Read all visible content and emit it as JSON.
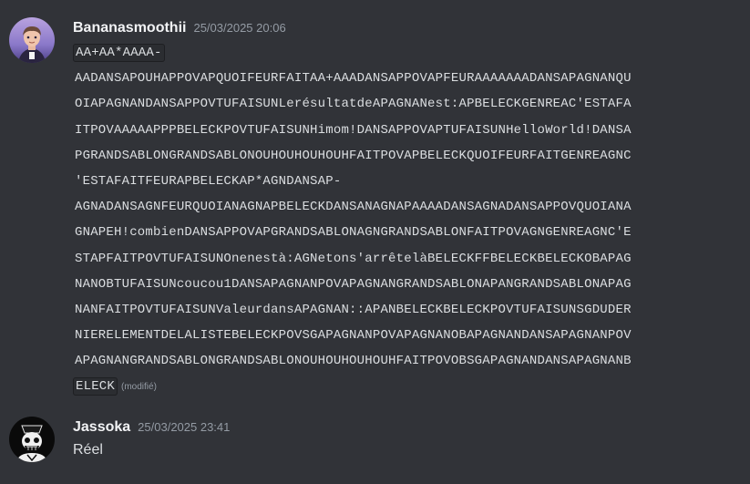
{
  "messages": [
    {
      "username": "Bananasmoothii",
      "timestamp": "25/03/2025 20:06",
      "lines": [
        "AA+AA*AAAA-",
        "AADANSAPOUHAPPOVAPQUOIFEURFAITAA+AAADANSAPPOVAPFEURAAAAAAADANSAPAGNANQU",
        "OIAPAGNANDANSAPPOVTUFAISUNLerésultatdeAPAGNANest:APBELECKGENREAC'ESTAFA",
        "ITPOVAAAAAPPPBELECKPOVTUFAISUNHimom!DANSAPPOVAPTUFAISUNHelloWorld!DANSA",
        "PGRANDSABLONGRANDSABLONOUHOUHOUHOUHFAITPOVAPBELECKQUOIFEURFAITGENREAGNC",
        "'ESTAFAITFEURAPBELECKAP*AGNDANSAP-",
        "AGNADANSAGNFEURQUOIANAGNAPBELECKDANSANAGNAPAAAADANSAGNADANSAPPOVQUOIANA",
        "GNAPEH!combienDANSAPPOVAPGRANDSABLONAGNGRANDSABLONFAITPOVAGNGENREAGNC'E",
        "STAPFAITPOVTUFAISUNOnenestà:AGNetons'arrêtelàBELECKFFBELECKBELECKOBAPAG",
        "NANOBTUFAISUNcoucou1DANSAPAGNANPOVAPAGNANGRANDSABLONAPANGRANDSABLONAPAG",
        "NANFAITPOVTUFAISUNValeurdansAPAGNAN::APANBELECKBELECKPOVTUFAISUNSGDUDER",
        "NIERELEMENTDELALISTEBELECKPOVSGAPAGNANPOVAPAGNANOBAPAGNANDANSAPAGNANPOV",
        "APAGNANGRANDSABLONGRANDSABLONOUHOUHOUHOUHFAITPOVOBSGAPAGNANDANSAPAGNANB",
        "ELECK"
      ],
      "edited_label": "(modifié)"
    },
    {
      "username": "Jassoka",
      "timestamp": "25/03/2025 23:41",
      "text": "Réel"
    }
  ],
  "colors": {
    "background": "#313338",
    "username": "#f2f3f5",
    "timestamp": "#949ba4",
    "text": "#dbdee1",
    "code_bg": "#2b2d31"
  }
}
